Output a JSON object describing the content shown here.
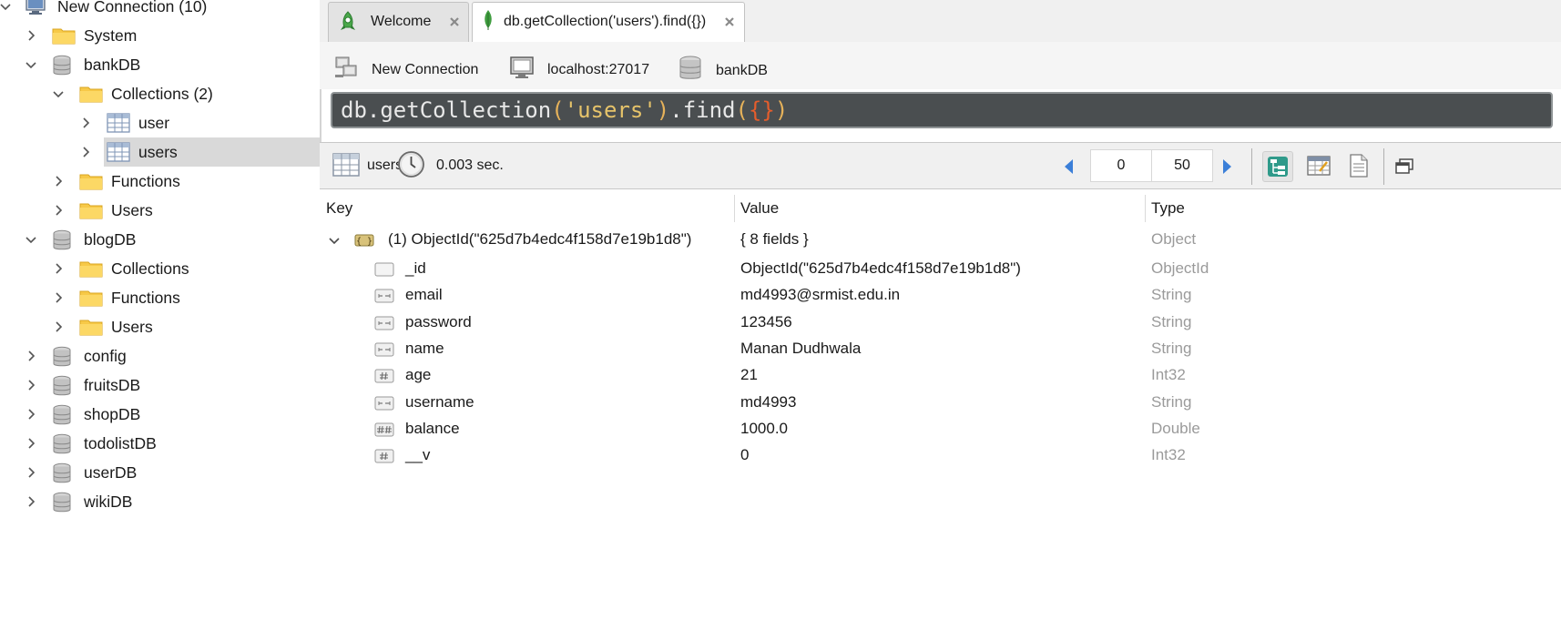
{
  "sidebar": {
    "items": [
      {
        "label": "New Connection (10)",
        "icon": "computer-icon",
        "expanded": true
      },
      {
        "label": "System",
        "icon": "folder-icon",
        "expanded": false
      },
      {
        "label": "bankDB",
        "icon": "database-icon",
        "expanded": true
      },
      {
        "label": "Collections (2)",
        "icon": "folder-icon",
        "expanded": true
      },
      {
        "label": "user",
        "icon": "collection-icon",
        "expanded": false
      },
      {
        "label": "users",
        "icon": "collection-icon",
        "expanded": false,
        "selected": true
      },
      {
        "label": "Functions",
        "icon": "folder-icon",
        "expanded": false
      },
      {
        "label": "Users",
        "icon": "folder-icon",
        "expanded": false
      },
      {
        "label": "blogDB",
        "icon": "database-icon",
        "expanded": true
      },
      {
        "label": "Collections",
        "icon": "folder-icon",
        "expanded": false
      },
      {
        "label": "Functions",
        "icon": "folder-icon",
        "expanded": false
      },
      {
        "label": "Users",
        "icon": "folder-icon",
        "expanded": false
      },
      {
        "label": "config",
        "icon": "database-icon",
        "expanded": false
      },
      {
        "label": "fruitsDB",
        "icon": "database-icon",
        "expanded": false
      },
      {
        "label": "shopDB",
        "icon": "database-icon",
        "expanded": false
      },
      {
        "label": "todolistDB",
        "icon": "database-icon",
        "expanded": false
      },
      {
        "label": "userDB",
        "icon": "database-icon",
        "expanded": false
      },
      {
        "label": "wikiDB",
        "icon": "database-icon",
        "expanded": false
      }
    ]
  },
  "tabs": [
    {
      "label": "Welcome",
      "icon": "robomongo-logo-icon",
      "active": false
    },
    {
      "label": "db.getCollection('users').find({})",
      "icon": "leaf-icon",
      "active": true
    }
  ],
  "connection_bar": {
    "connection": "New Connection",
    "server": "localhost:27017",
    "database": "bankDB"
  },
  "query": {
    "prefix": "db.getCollection",
    "open_paren": "(",
    "string": "'users'",
    "close_paren": ")",
    "method": ".find",
    "open_paren2": "(",
    "braces": "{}",
    "close_paren2": ")"
  },
  "results_toolbar": {
    "collection": "users",
    "time": "0.003 sec.",
    "skip": "0",
    "limit": "50"
  },
  "results": {
    "columns": [
      "Key",
      "Value",
      "Type"
    ],
    "root": {
      "key": "(1) ObjectId(\"625d7b4edc4f158d7e19b1d8\")",
      "value": "{ 8 fields }",
      "type": "Object"
    },
    "fields": [
      {
        "key": "_id",
        "value": "ObjectId(\"625d7b4edc4f158d7e19b1d8\")",
        "type": "ObjectId",
        "icon": "objectid-field-icon"
      },
      {
        "key": "email",
        "value": "md4993@srmist.edu.in",
        "type": "String",
        "icon": "string-field-icon"
      },
      {
        "key": "password",
        "value": "123456",
        "type": "String",
        "icon": "string-field-icon"
      },
      {
        "key": "name",
        "value": "Manan Dudhwala",
        "type": "String",
        "icon": "string-field-icon"
      },
      {
        "key": "age",
        "value": "21",
        "type": "Int32",
        "icon": "integer-field-icon"
      },
      {
        "key": "username",
        "value": "md4993",
        "type": "String",
        "icon": "string-field-icon"
      },
      {
        "key": "balance",
        "value": "1000.0",
        "type": "Double",
        "icon": "double-field-icon"
      },
      {
        "key": "__v",
        "value": "0",
        "type": "Int32",
        "icon": "integer-field-icon"
      }
    ]
  },
  "colors": {
    "selection": "#d9d9d9",
    "query_background": "#4a4e50",
    "type_text": "#9a9a9a",
    "folder": "#f5c518"
  }
}
